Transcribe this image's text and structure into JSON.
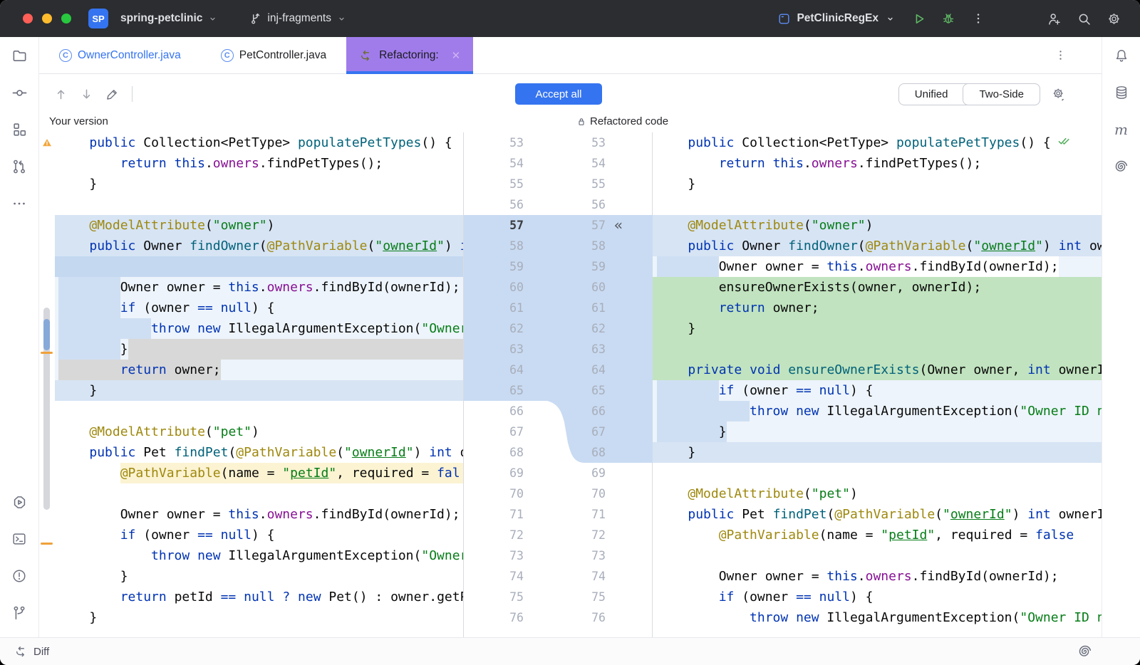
{
  "titlebar": {
    "project_abbrev": "SP",
    "project_name": "spring-petclinic",
    "branch_name": "inj-fragments",
    "run_config": "PetClinicRegEx"
  },
  "tabs": [
    {
      "label": "OwnerController.java",
      "state": "modified"
    },
    {
      "label": "PetController.java",
      "state": "normal"
    },
    {
      "label": "Refactoring:",
      "state": "selected"
    }
  ],
  "toolbar": {
    "accept_all": "Accept all",
    "view_modes": [
      "Unified",
      "Two-Side"
    ],
    "selected_view": "Two-Side"
  },
  "headers": {
    "left": "Your version",
    "right": "Refactored code"
  },
  "statusbar": {
    "label": "Diff"
  },
  "icons": {
    "maven_glyph": "m",
    "chunk_chevrons": "«",
    "tab_close": "✕"
  },
  "colors": {
    "accent": "#3574f0",
    "tab_selected": "#a07ceb",
    "added_bg": "#c1e3bf",
    "changed_bg": "#d7e4f4",
    "warning": "#f2a63b",
    "ok_check": "#4dab56",
    "titlebar_bg": "#2b2d30",
    "run_green": "#5fb865"
  },
  "diff": {
    "first_line": 53,
    "last_line": 76,
    "gutter": {
      "hl_start": 57,
      "left_hl_end": 65,
      "right_hl_end": 68,
      "marker_line": 57
    },
    "left_lines": [
      {
        "segs": [
          [
            "p",
            "    "
          ],
          [
            "k",
            "public"
          ],
          [
            "p",
            " Collection<PetType> "
          ],
          [
            "m",
            "populatePetTypes"
          ],
          [
            "p",
            "() {"
          ]
        ],
        "mark": "warn"
      },
      {
        "segs": [
          [
            "p",
            "        "
          ],
          [
            "k",
            "return"
          ],
          [
            "p",
            " "
          ],
          [
            "k",
            "this"
          ],
          [
            "p",
            "."
          ],
          [
            "f",
            "owners"
          ],
          [
            "p",
            ".findPetTypes();"
          ]
        ]
      },
      {
        "segs": [
          [
            "p",
            "    }"
          ]
        ]
      },
      {
        "segs": []
      },
      {
        "bg": "blue",
        "segs": [
          [
            "p",
            "    "
          ],
          [
            "a",
            "@ModelAttribute"
          ],
          [
            "p",
            "("
          ],
          [
            "s",
            "\"owner\""
          ],
          [
            "p",
            ")"
          ]
        ]
      },
      {
        "bg": "blue",
        "segs": [
          [
            "p",
            "    "
          ],
          [
            "k",
            "public"
          ],
          [
            "p",
            " Owner "
          ],
          [
            "m",
            "findOwner"
          ],
          [
            "p",
            "("
          ],
          [
            "a",
            "@PathVariable"
          ],
          [
            "p",
            "("
          ],
          [
            "s",
            "\""
          ],
          [
            "u",
            "ownerId"
          ],
          [
            "s",
            "\""
          ],
          [
            "p",
            ") "
          ],
          [
            "k",
            "int"
          ]
        ]
      },
      {
        "bg": "bluedark",
        "segs": []
      },
      {
        "bg": "bluelight",
        "ind": 1,
        "segs": [
          [
            "p",
            "        "
          ],
          [
            "p",
            "Owner owner = "
          ],
          [
            "k",
            "this"
          ],
          [
            "p",
            "."
          ],
          [
            "f",
            "owners"
          ],
          [
            "p",
            ".findById(ownerId);"
          ]
        ]
      },
      {
        "bg": "bluelight",
        "ind": 1,
        "segs": [
          [
            "p",
            "        "
          ],
          [
            "k",
            "if"
          ],
          [
            "p",
            " (owner "
          ],
          [
            "k",
            "=="
          ],
          [
            "p",
            " "
          ],
          [
            "k",
            "null"
          ],
          [
            "p",
            ") {"
          ]
        ]
      },
      {
        "bg": "bluelight",
        "ind": 1,
        "segs": [
          [
            "p",
            "            "
          ],
          [
            "k",
            "throw"
          ],
          [
            "p",
            " "
          ],
          [
            "k",
            "new"
          ],
          [
            "p",
            " IllegalArgumentException("
          ],
          [
            "s",
            "\"Owner ID"
          ]
        ]
      },
      {
        "bg": "bluelight",
        "ind": 1,
        "mark": "fillgray",
        "segs": [
          [
            "p",
            "        "
          ],
          [
            "p",
            "}"
          ]
        ]
      },
      {
        "bg": "bluelight",
        "mark": "textgray",
        "segs": [
          [
            "p",
            "        "
          ],
          [
            "k",
            "return"
          ],
          [
            "p",
            " owner;"
          ]
        ]
      },
      {
        "bg": "blue",
        "segs": [
          [
            "p",
            "    }"
          ]
        ]
      },
      {
        "segs": []
      },
      {
        "segs": [
          [
            "p",
            "    "
          ],
          [
            "a",
            "@ModelAttribute"
          ],
          [
            "p",
            "("
          ],
          [
            "s",
            "\"pet\""
          ],
          [
            "p",
            ")"
          ]
        ]
      },
      {
        "segs": [
          [
            "p",
            "    "
          ],
          [
            "k",
            "public"
          ],
          [
            "p",
            " Pet "
          ],
          [
            "m",
            "findPet"
          ],
          [
            "p",
            "("
          ],
          [
            "a",
            "@PathVariable"
          ],
          [
            "p",
            "("
          ],
          [
            "s",
            "\""
          ],
          [
            "u",
            "ownerId"
          ],
          [
            "s",
            "\""
          ],
          [
            "p",
            ") "
          ],
          [
            "k",
            "int"
          ],
          [
            "p",
            " owne"
          ]
        ]
      },
      {
        "mark": "yellow",
        "segs": [
          [
            "p",
            "        "
          ],
          [
            "a",
            "@PathVariable"
          ],
          [
            "p",
            "(name = "
          ],
          [
            "s",
            "\""
          ],
          [
            "u",
            "petId"
          ],
          [
            "s",
            "\""
          ],
          [
            "p",
            ", required = "
          ],
          [
            "k",
            "fal"
          ]
        ]
      },
      {
        "segs": []
      },
      {
        "segs": [
          [
            "p",
            "        "
          ],
          [
            "p",
            "Owner owner = "
          ],
          [
            "k",
            "this"
          ],
          [
            "p",
            "."
          ],
          [
            "f",
            "owners"
          ],
          [
            "p",
            ".findById(ownerId);"
          ]
        ]
      },
      {
        "segs": [
          [
            "p",
            "        "
          ],
          [
            "k",
            "if"
          ],
          [
            "p",
            " (owner "
          ],
          [
            "k",
            "=="
          ],
          [
            "p",
            " "
          ],
          [
            "k",
            "null"
          ],
          [
            "p",
            ") {"
          ]
        ]
      },
      {
        "segs": [
          [
            "p",
            "            "
          ],
          [
            "k",
            "throw"
          ],
          [
            "p",
            " "
          ],
          [
            "k",
            "new"
          ],
          [
            "p",
            " IllegalArgumentException("
          ],
          [
            "s",
            "\"Owner ID"
          ]
        ]
      },
      {
        "segs": [
          [
            "p",
            "        }"
          ]
        ]
      },
      {
        "segs": [
          [
            "p",
            "        "
          ],
          [
            "k",
            "return"
          ],
          [
            "p",
            " petId "
          ],
          [
            "k",
            "=="
          ],
          [
            "p",
            " "
          ],
          [
            "k",
            "null"
          ],
          [
            "p",
            " "
          ],
          [
            "k",
            "?"
          ],
          [
            "p",
            " "
          ],
          [
            "k",
            "new"
          ],
          [
            "p",
            " Pet() : owner.getPet("
          ]
        ]
      },
      {
        "segs": [
          [
            "p",
            "    }"
          ]
        ]
      }
    ],
    "right_lines": [
      {
        "segs": [
          [
            "p",
            "    "
          ],
          [
            "k",
            "public"
          ],
          [
            "p",
            " Collection<PetType> "
          ],
          [
            "m",
            "populatePetTypes"
          ],
          [
            "p",
            "() {"
          ]
        ],
        "mark": "check"
      },
      {
        "segs": [
          [
            "p",
            "        "
          ],
          [
            "k",
            "return"
          ],
          [
            "p",
            " "
          ],
          [
            "k",
            "this"
          ],
          [
            "p",
            "."
          ],
          [
            "f",
            "owners"
          ],
          [
            "p",
            ".findPetTypes();"
          ]
        ]
      },
      {
        "segs": [
          [
            "p",
            "    }"
          ]
        ]
      },
      {
        "segs": []
      },
      {
        "bg": "blue",
        "segs": [
          [
            "p",
            "    "
          ],
          [
            "a",
            "@ModelAttribute"
          ],
          [
            "p",
            "("
          ],
          [
            "s",
            "\"owner\""
          ],
          [
            "p",
            ")"
          ]
        ]
      },
      {
        "bg": "blue",
        "segs": [
          [
            "p",
            "    "
          ],
          [
            "k",
            "public"
          ],
          [
            "p",
            " Owner "
          ],
          [
            "m",
            "findOwner"
          ],
          [
            "p",
            "("
          ],
          [
            "a",
            "@PathVariable"
          ],
          [
            "p",
            "("
          ],
          [
            "s",
            "\""
          ],
          [
            "u",
            "ownerId"
          ],
          [
            "s",
            "\""
          ],
          [
            "p",
            ") "
          ],
          [
            "k",
            "int"
          ],
          [
            "p",
            " ow"
          ]
        ]
      },
      {
        "bg": "bluelight",
        "ind": 1,
        "mark": "codewhite",
        "segs": [
          [
            "p",
            "        "
          ],
          [
            "p",
            "Owner owner = "
          ],
          [
            "k",
            "this"
          ],
          [
            "p",
            "."
          ],
          [
            "f",
            "owners"
          ],
          [
            "p",
            ".findById(ownerId);"
          ]
        ]
      },
      {
        "bg": "green",
        "segs": [
          [
            "p",
            "        "
          ],
          [
            "p",
            "ensureOwnerExists(owner, ownerId);"
          ]
        ]
      },
      {
        "bg": "green",
        "segs": [
          [
            "p",
            "        "
          ],
          [
            "k",
            "return"
          ],
          [
            "p",
            " owner;"
          ]
        ]
      },
      {
        "bg": "green",
        "segs": [
          [
            "p",
            "    }"
          ]
        ]
      },
      {
        "bg": "green",
        "segs": []
      },
      {
        "bg": "green",
        "segs": [
          [
            "p",
            "    "
          ],
          [
            "k",
            "private"
          ],
          [
            "p",
            " "
          ],
          [
            "k",
            "void"
          ],
          [
            "p",
            " "
          ],
          [
            "m",
            "ensureOwnerExists"
          ],
          [
            "p",
            "(Owner owner, "
          ],
          [
            "k",
            "int"
          ],
          [
            "p",
            " ownerI"
          ]
        ]
      },
      {
        "bg": "bluelight",
        "ind": 1,
        "segs": [
          [
            "p",
            "        "
          ],
          [
            "k",
            "if"
          ],
          [
            "p",
            " (owner "
          ],
          [
            "k",
            "=="
          ],
          [
            "p",
            " "
          ],
          [
            "k",
            "null"
          ],
          [
            "p",
            ") {"
          ]
        ]
      },
      {
        "bg": "bluelight",
        "ind": 1,
        "segs": [
          [
            "p",
            "            "
          ],
          [
            "k",
            "throw"
          ],
          [
            "p",
            " "
          ],
          [
            "k",
            "new"
          ],
          [
            "p",
            " IllegalArgumentException("
          ],
          [
            "s",
            "\"Owner ID n"
          ]
        ]
      },
      {
        "bg": "bluelight",
        "ind": 1,
        "segs": [
          [
            "p",
            "        }"
          ]
        ]
      },
      {
        "bg": "blue",
        "segs": [
          [
            "p",
            "    }"
          ]
        ]
      },
      {
        "segs": []
      },
      {
        "segs": [
          [
            "p",
            "    "
          ],
          [
            "a",
            "@ModelAttribute"
          ],
          [
            "p",
            "("
          ],
          [
            "s",
            "\"pet\""
          ],
          [
            "p",
            ")"
          ]
        ]
      },
      {
        "segs": [
          [
            "p",
            "    "
          ],
          [
            "k",
            "public"
          ],
          [
            "p",
            " Pet "
          ],
          [
            "m",
            "findPet"
          ],
          [
            "p",
            "("
          ],
          [
            "a",
            "@PathVariable"
          ],
          [
            "p",
            "("
          ],
          [
            "s",
            "\""
          ],
          [
            "u",
            "ownerId"
          ],
          [
            "s",
            "\""
          ],
          [
            "p",
            ") "
          ],
          [
            "k",
            "int"
          ],
          [
            "p",
            " ownerI"
          ]
        ]
      },
      {
        "segs": [
          [
            "p",
            "        "
          ],
          [
            "a",
            "@PathVariable"
          ],
          [
            "p",
            "(name = "
          ],
          [
            "s",
            "\""
          ],
          [
            "u",
            "petId"
          ],
          [
            "s",
            "\""
          ],
          [
            "p",
            ", required = "
          ],
          [
            "k",
            "false"
          ]
        ]
      },
      {
        "segs": []
      },
      {
        "segs": [
          [
            "p",
            "        "
          ],
          [
            "p",
            "Owner owner = "
          ],
          [
            "k",
            "this"
          ],
          [
            "p",
            "."
          ],
          [
            "f",
            "owners"
          ],
          [
            "p",
            ".findById(ownerId);"
          ]
        ]
      },
      {
        "segs": [
          [
            "p",
            "        "
          ],
          [
            "k",
            "if"
          ],
          [
            "p",
            " (owner "
          ],
          [
            "k",
            "=="
          ],
          [
            "p",
            " "
          ],
          [
            "k",
            "null"
          ],
          [
            "p",
            ") {"
          ]
        ]
      },
      {
        "segs": [
          [
            "p",
            "            "
          ],
          [
            "k",
            "throw"
          ],
          [
            "p",
            " "
          ],
          [
            "k",
            "new"
          ],
          [
            "p",
            " IllegalArgumentException("
          ],
          [
            "s",
            "\"Owner ID n"
          ]
        ]
      }
    ]
  }
}
